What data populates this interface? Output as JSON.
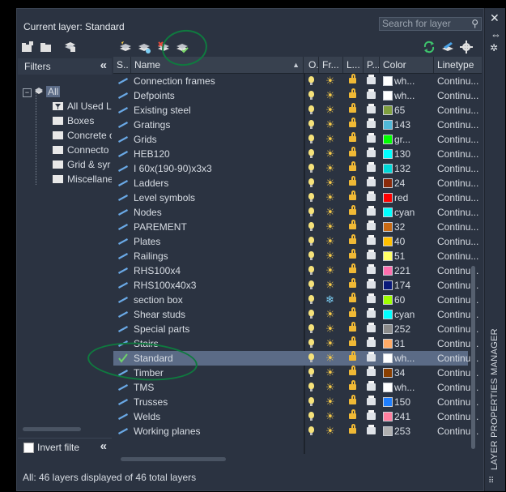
{
  "window": {
    "current_layer_label": "Current layer: Standard",
    "search_placeholder": "Search for layer",
    "side_title": "LAYER PROPERTIES MANAGER",
    "status": "All: 46 layers displayed of 46 total layers"
  },
  "filters": {
    "header": "Filters",
    "collapse_label": "«",
    "tree": [
      {
        "label": "All",
        "level": 0,
        "selected": true
      },
      {
        "label": "All Used L",
        "level": 1
      },
      {
        "label": "Boxes",
        "level": 1
      },
      {
        "label": "Concrete c",
        "level": 1
      },
      {
        "label": "Connecto",
        "level": 1
      },
      {
        "label": "Grid & syr",
        "level": 1
      },
      {
        "label": "Miscellane",
        "level": 1
      }
    ],
    "invert_label": "Invert filte",
    "invert_checked": false
  },
  "grid": {
    "headers": {
      "status": "S..",
      "name": "Name",
      "on": "O..",
      "freeze": "Fr...",
      "lock": "L...",
      "plot": "P...",
      "color": "Color",
      "linetype": "Linetype"
    },
    "rows": [
      {
        "name": "Connection frames",
        "freeze": "sun",
        "color": "wh...",
        "swatch": "#ffffff",
        "linetype": "Continu..."
      },
      {
        "name": "Defpoints",
        "freeze": "sun",
        "color": "wh...",
        "swatch": "#ffffff",
        "linetype": "Continu..."
      },
      {
        "name": "Existing steel",
        "freeze": "sun",
        "color": "65",
        "swatch": "#7f9f3f",
        "linetype": "Continu..."
      },
      {
        "name": "Gratings",
        "freeze": "sun",
        "color": "143",
        "swatch": "#4fb8d8",
        "linetype": "Continu..."
      },
      {
        "name": "Grids",
        "freeze": "sun",
        "color": "gr...",
        "swatch": "#00ff00",
        "linetype": "Continu..."
      },
      {
        "name": "HEB120",
        "freeze": "sun",
        "color": "130",
        "swatch": "#00ffff",
        "linetype": "Continu..."
      },
      {
        "name": "I 60x(190-90)x3x3",
        "freeze": "sun",
        "color": "132",
        "swatch": "#00d8d8",
        "linetype": "Continu..."
      },
      {
        "name": "Ladders",
        "freeze": "sun",
        "color": "24",
        "swatch": "#8a2a0a",
        "linetype": "Continu..."
      },
      {
        "name": "Level symbols",
        "freeze": "sun",
        "color": "red",
        "swatch": "#ff0000",
        "linetype": "Continu..."
      },
      {
        "name": "Nodes",
        "freeze": "sun",
        "color": "cyan",
        "swatch": "#00ffff",
        "linetype": "Continu..."
      },
      {
        "name": "PAREMENT",
        "freeze": "sun",
        "color": "32",
        "swatch": "#c86a14",
        "linetype": "Continu..."
      },
      {
        "name": "Plates",
        "freeze": "sun",
        "color": "40",
        "swatch": "#ffbf00",
        "linetype": "Continu..."
      },
      {
        "name": "Railings",
        "freeze": "sun",
        "color": "51",
        "swatch": "#ffff66",
        "linetype": "Continu..."
      },
      {
        "name": "RHS100x4",
        "freeze": "sun",
        "color": "221",
        "swatch": "#ff6fae",
        "linetype": "Continu..."
      },
      {
        "name": "RHS100x40x3",
        "freeze": "sun",
        "color": "174",
        "swatch": "#0a1a7a",
        "linetype": "Continu..."
      },
      {
        "name": "section box",
        "freeze": "snow",
        "color": "60",
        "swatch": "#9fff00",
        "linetype": "Continu..."
      },
      {
        "name": "Shear studs",
        "freeze": "sun",
        "color": "cyan",
        "swatch": "#00ffff",
        "linetype": "Continu..."
      },
      {
        "name": "Special parts",
        "freeze": "sun",
        "color": "252",
        "swatch": "#8a8a8a",
        "linetype": "Continu..."
      },
      {
        "name": "Stairs",
        "freeze": "sun",
        "color": "31",
        "swatch": "#ffaa66",
        "linetype": "Continu..."
      },
      {
        "name": "Standard",
        "freeze": "sun",
        "color": "wh...",
        "swatch": "#ffffff",
        "linetype": "Continu...",
        "current": true
      },
      {
        "name": "Timber",
        "freeze": "sun",
        "color": "34",
        "swatch": "#8a3f00",
        "linetype": "Continu..."
      },
      {
        "name": "TMS",
        "freeze": "sun",
        "color": "wh...",
        "swatch": "#ffffff",
        "linetype": "Continu..."
      },
      {
        "name": "Trusses",
        "freeze": "sun",
        "color": "150",
        "swatch": "#1f7fff",
        "linetype": "Continu..."
      },
      {
        "name": "Welds",
        "freeze": "sun",
        "color": "241",
        "swatch": "#ff7f9f",
        "linetype": "Continu..."
      },
      {
        "name": "Working planes",
        "freeze": "sun",
        "color": "253",
        "swatch": "#b0b0b0",
        "linetype": "Continu..."
      }
    ]
  },
  "colors": {
    "annotation": "#0f7a3f",
    "selection": "#5b6b86",
    "panel": "#2b3341"
  }
}
